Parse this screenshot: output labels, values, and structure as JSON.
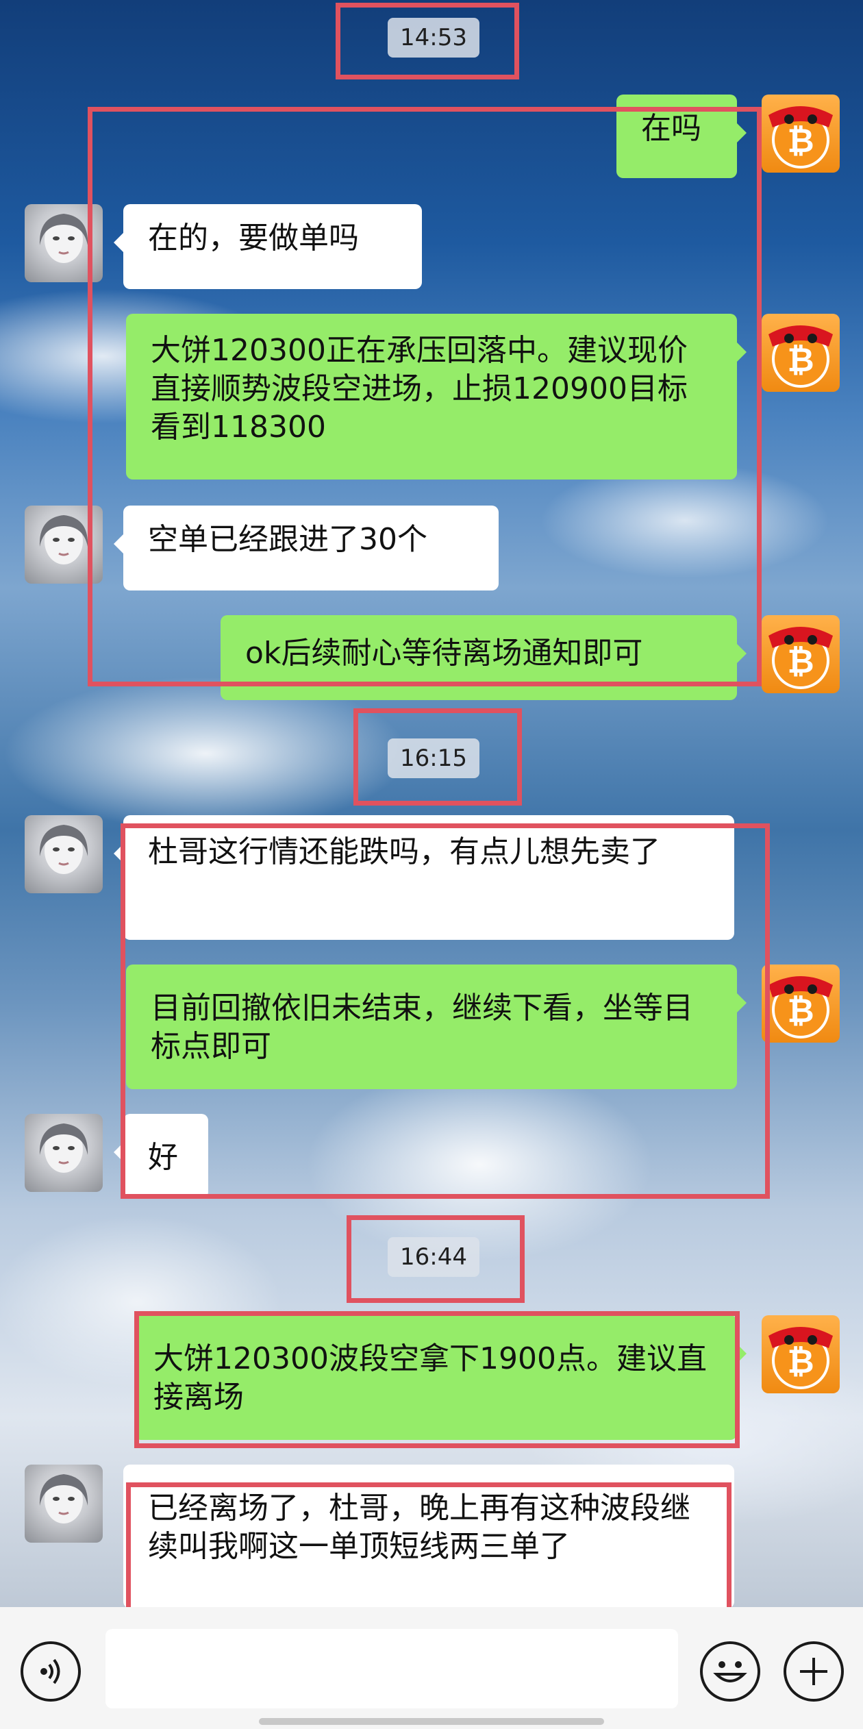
{
  "timestamps": [
    "14:53",
    "16:15",
    "16:44"
  ],
  "messages": [
    {
      "from": "me",
      "text": "在吗"
    },
    {
      "from": "her",
      "text": "在的，要做单吗"
    },
    {
      "from": "me",
      "text": "大饼120300正在承压回落中。建议现价直接顺势波段空进场，止损120900目标看到118300"
    },
    {
      "from": "her",
      "text": "空单已经跟进了30个"
    },
    {
      "from": "me",
      "text": "ok后续耐心等待离场通知即可"
    },
    {
      "from": "her",
      "text": "杜哥这行情还能跌吗，有点儿想先卖了"
    },
    {
      "from": "me",
      "text": "目前回撤依旧未结束，继续下看，坐等目标点即可"
    },
    {
      "from": "her",
      "text": "好"
    },
    {
      "from": "me",
      "text": "大饼120300波段空拿下1900点。建议直接离场"
    },
    {
      "from": "her",
      "text": "已经离场了，杜哥，晚上再有这种波段继续叫我啊这一单顶短线两三单了"
    }
  ],
  "colors": {
    "outgoing_bubble": "#95ec69",
    "incoming_bubble": "#ffffff",
    "highlight_box": "#e0525f"
  },
  "input_bar": {
    "left_icon": "voice-icon",
    "right_icons": [
      "emoji-icon",
      "plus-icon"
    ]
  }
}
